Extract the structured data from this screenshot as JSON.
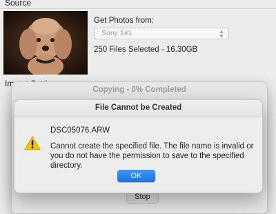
{
  "source": {
    "section_label": "Source",
    "get_photos_label": "Get Photos from:",
    "selected_device": "Sony 1#1",
    "files_selected": "250 Files Selected - 16.30GB"
  },
  "import_settings": {
    "section_label": "Import Settin"
  },
  "copy_progress": {
    "title": "Copying - 0% Completed",
    "stop_label": "Stop"
  },
  "error_dialog": {
    "title": "File Cannot be Created",
    "file_name": "DSC05076.ARW",
    "message": "Cannot create the specified file. The file name is invalid or you do not have the permission to save to the specified directory.",
    "ok_label": "OK",
    "accent_color": "#1a71e8",
    "icon": "warning-icon"
  }
}
